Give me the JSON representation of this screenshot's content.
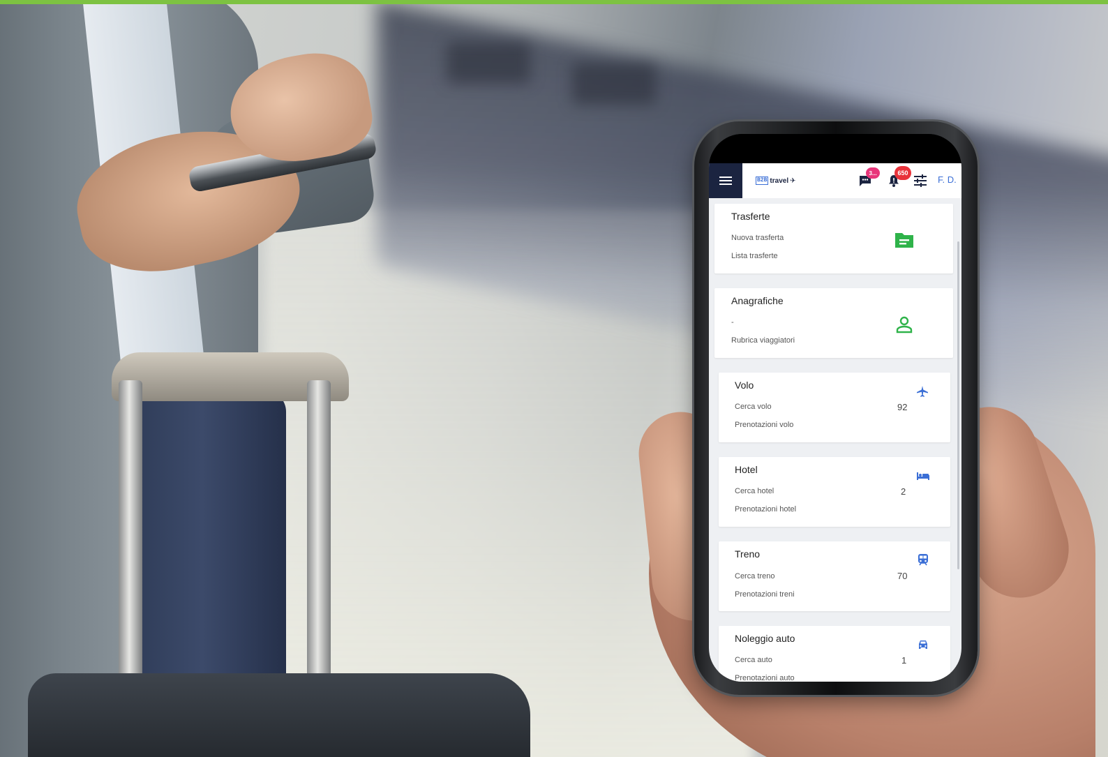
{
  "header": {
    "logo_box": "B2B",
    "logo_word": "travel",
    "chat_badge": "3...",
    "bell_badge": "650",
    "user_initials": "F. D."
  },
  "cards": [
    {
      "title": "Trasferte",
      "link1": "Nuova trasferta",
      "link2": "Lista trasferte",
      "count": "",
      "icon": "folder-icon",
      "icon_color": "#2fb34a"
    },
    {
      "title": "Anagrafiche",
      "link1": "-",
      "link2": "Rubrica viaggiatori",
      "count": "",
      "icon": "person-icon",
      "icon_color": "#2fb34a"
    },
    {
      "title": "Volo",
      "link1": "Cerca volo",
      "link2": "Prenotazioni volo",
      "count": "92",
      "icon": "airplane-icon",
      "icon_color": "#3b6fd6"
    },
    {
      "title": "Hotel",
      "link1": "Cerca hotel",
      "link2": "Prenotazioni hotel",
      "count": "2",
      "icon": "bed-icon",
      "icon_color": "#3b6fd6"
    },
    {
      "title": "Treno",
      "link1": "Cerca treno",
      "link2": "Prenotazioni treni",
      "count": "70",
      "icon": "train-icon",
      "icon_color": "#3b6fd6"
    },
    {
      "title": "Noleggio auto",
      "link1": "Cerca auto",
      "link2": "Prenotazioni auto",
      "count": "1",
      "icon": "car-icon",
      "icon_color": "#3b6fd6"
    }
  ],
  "colors": {
    "accent_green": "#7dc242",
    "header_dark": "#1b2440",
    "link_blue": "#3b6fd6"
  }
}
